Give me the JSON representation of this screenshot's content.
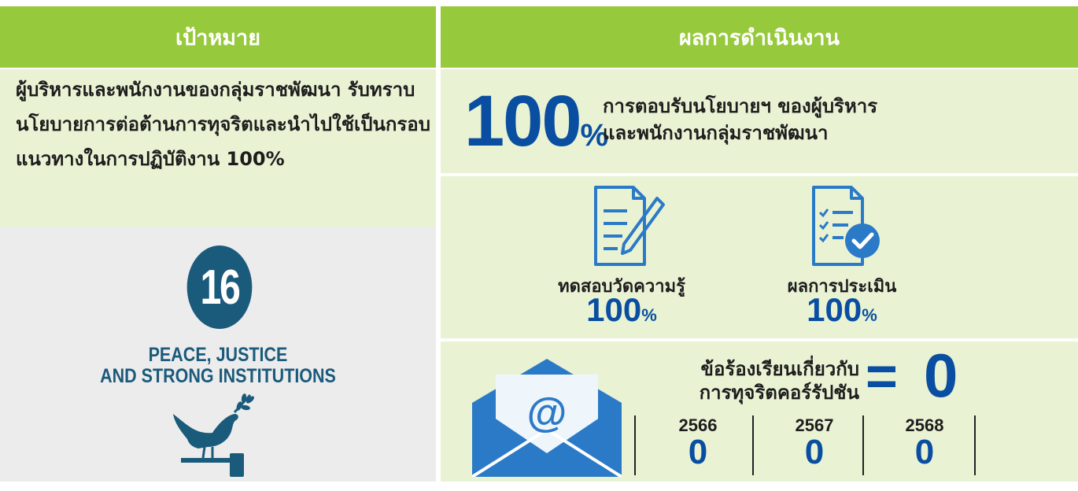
{
  "header": {
    "goal_label": "เป้าหมาย",
    "result_label": "ผลการดำเนินงาน"
  },
  "goal": {
    "text": "ผู้บริหารและพนักงานของกลุ่มราชพัฒนา รับทราบนโยบายการต่อต้านการทุจริตและนำไปใช้เป็นกรอบแนวทางในการปฏิบัติงาน 100%"
  },
  "sdg": {
    "number": "16",
    "title_line1": "PEACE, JUSTICE",
    "title_line2": "AND STRONG INSTITUTIONS",
    "icon": "dove-gavel-icon"
  },
  "acceptance": {
    "value": "100",
    "unit": "%",
    "line1": "การตอบรับนโยบายฯ ของผู้บริหาร",
    "line2": "และพนักงานกลุ่มราชพัฒนา"
  },
  "stats": [
    {
      "label": "ทดสอบวัดความรู้",
      "value": "100",
      "unit": "%",
      "icon": "document-pencil-icon"
    },
    {
      "label": "ผลการประเมิน",
      "value": "100",
      "unit": "%",
      "icon": "checklist-check-icon"
    }
  ],
  "complaints": {
    "line1": "ข้อร้องเรียนเกี่ยวกับ",
    "line2": "การทุจริตคอร์รัปชัน",
    "equals": "=",
    "total": "0",
    "icon": "email-at-icon",
    "years": [
      {
        "year": "2566",
        "count": "0"
      },
      {
        "year": "2567",
        "count": "0"
      },
      {
        "year": "2568",
        "count": "0"
      }
    ]
  },
  "colors": {
    "header_green": "#97c93d",
    "cell_bg": "#e9f3d4",
    "accent_blue": "#0a4ea1",
    "sdg_blue": "#1a5a7b",
    "icon_blue": "#2b7ac7"
  }
}
